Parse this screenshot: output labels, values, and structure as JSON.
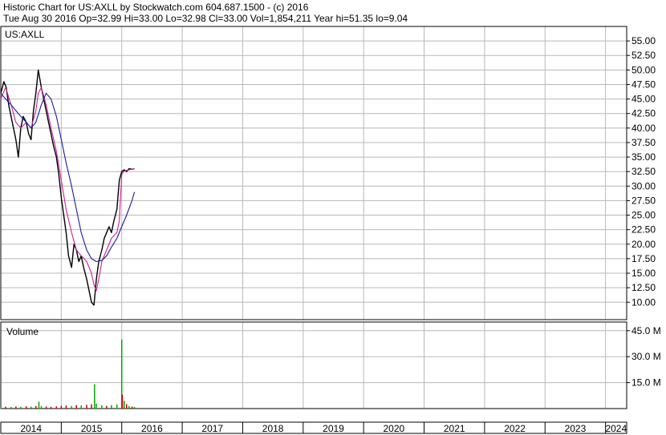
{
  "header": {
    "line1": "Historic Chart for US:AXLL by Stockwatch.com 604.687.1500 - (c) 2016",
    "line2": "Tue Aug 30 2016  Op=32.99  Hi=33.00  Lo=32.98  Cl=33.00  Vol=1,854,211  Year hi=51.35  lo=9.04"
  },
  "chart_data": [
    {
      "type": "line",
      "title": "US:AXLL",
      "ylim": [
        7,
        57.5
      ],
      "y_ticks": [
        "55.00",
        "52.50",
        "50.00",
        "47.50",
        "45.00",
        "42.50",
        "40.00",
        "37.50",
        "35.00",
        "32.50",
        "30.00",
        "27.50",
        "25.00",
        "22.50",
        "20.00",
        "17.50",
        "15.00",
        "12.50",
        "10.00"
      ],
      "y_tick_values": [
        55,
        52.5,
        50,
        47.5,
        45,
        42.5,
        40,
        37.5,
        35,
        32.5,
        30,
        27.5,
        25,
        22.5,
        20,
        17.5,
        15,
        12.5,
        10
      ],
      "x_ticks": [
        "2014",
        "2015",
        "2016",
        "2017",
        "2018",
        "2019",
        "2020",
        "2021",
        "2022",
        "2023",
        "2024"
      ],
      "xlim": [
        2014,
        2024.35
      ],
      "grid": true,
      "price_color": "#000000",
      "series": [
        {
          "kind": "price",
          "x": [
            2014.0,
            2014.05,
            2014.09,
            2014.13,
            2014.17,
            2014.21,
            2014.25,
            2014.29,
            2014.33,
            2014.37,
            2014.42,
            2014.46,
            2014.5,
            2014.54,
            2014.58,
            2014.62,
            2014.67,
            2014.71,
            2014.75,
            2014.79,
            2014.83,
            2014.87,
            2014.92,
            2014.96,
            2015.0,
            2015.04,
            2015.08,
            2015.12,
            2015.17,
            2015.21,
            2015.25,
            2015.29,
            2015.33,
            2015.37,
            2015.42,
            2015.46,
            2015.5,
            2015.54,
            2015.58,
            2015.62,
            2015.67,
            2015.71,
            2015.75,
            2015.79,
            2015.83,
            2015.87,
            2015.92,
            2015.96,
            2016.0,
            2016.04,
            2016.08,
            2016.12,
            2016.17,
            2016.21
          ],
          "y": [
            46,
            48,
            47,
            44,
            42,
            40,
            38,
            35,
            40,
            42,
            41,
            39,
            38,
            43,
            46,
            50,
            47,
            45,
            43,
            41,
            39,
            37,
            35,
            32,
            28,
            25,
            22,
            18,
            16,
            20,
            19,
            17,
            18,
            16,
            14,
            12,
            10,
            9.5,
            14,
            17,
            19,
            21,
            22,
            23,
            22,
            24,
            26,
            31,
            32.5,
            32.8,
            32.5,
            33,
            32.9,
            33
          ]
        },
        {
          "kind": "moving_average_short",
          "color": "#cc2299",
          "x": [
            2014.0,
            2014.08,
            2014.17,
            2014.25,
            2014.33,
            2014.42,
            2014.5,
            2014.58,
            2014.62,
            2014.67,
            2014.75,
            2014.83,
            2014.92,
            2015.0,
            2015.08,
            2015.17,
            2015.25,
            2015.33,
            2015.42,
            2015.5,
            2015.54,
            2015.58,
            2015.62,
            2015.67,
            2015.75,
            2015.83,
            2015.92,
            2015.96,
            2016.0,
            2016.04,
            2016.08,
            2016.12,
            2016.17,
            2016.21
          ],
          "y": [
            45,
            47,
            44,
            41,
            40,
            41,
            40,
            43,
            46,
            47,
            44,
            40,
            36,
            31,
            26,
            22,
            19,
            18,
            17,
            15,
            13,
            12,
            14,
            17,
            19,
            21,
            22,
            24,
            32,
            32.6,
            32.7,
            32.8,
            32.9,
            33
          ]
        },
        {
          "kind": "moving_average_long",
          "color": "#1a1aa0",
          "x": [
            2014.0,
            2014.08,
            2014.17,
            2014.25,
            2014.33,
            2014.42,
            2014.5,
            2014.58,
            2014.67,
            2014.75,
            2014.83,
            2014.92,
            2015.0,
            2015.08,
            2015.17,
            2015.25,
            2015.33,
            2015.42,
            2015.5,
            2015.58,
            2015.67,
            2015.75,
            2015.83,
            2015.92,
            2016.0,
            2016.08,
            2016.17,
            2016.21
          ],
          "y": [
            46,
            45,
            44,
            43,
            42,
            41,
            40,
            41,
            44,
            46,
            45,
            42,
            38,
            34,
            30,
            26,
            22,
            19,
            17.5,
            17,
            17.2,
            18,
            19.5,
            21,
            23,
            25,
            27.5,
            29
          ]
        }
      ]
    },
    {
      "type": "bar",
      "title": "Volume",
      "ylim": [
        0,
        50
      ],
      "y_ticks": [
        "45.0 M",
        "30.0 M",
        "15.0 M"
      ],
      "y_tick_values": [
        45,
        30,
        15
      ],
      "xlim": [
        2014,
        2024.35
      ],
      "colors": {
        "up": "#00aa00",
        "down": "#cc0000"
      },
      "x": [
        2014.0,
        2014.08,
        2014.17,
        2014.25,
        2014.33,
        2014.42,
        2014.5,
        2014.58,
        2014.63,
        2014.67,
        2014.75,
        2014.83,
        2014.92,
        2015.0,
        2015.08,
        2015.17,
        2015.25,
        2015.33,
        2015.42,
        2015.5,
        2015.55,
        2015.58,
        2015.67,
        2015.75,
        2015.83,
        2015.92,
        2016.0,
        2016.01,
        2016.04,
        2016.08,
        2016.12,
        2016.17,
        2016.21
      ],
      "values": [
        0.8,
        1.1,
        0.9,
        1.2,
        1.0,
        1.3,
        1.1,
        1.5,
        4.0,
        1.4,
        1.2,
        1.0,
        1.3,
        1.6,
        1.8,
        1.5,
        2.0,
        1.8,
        2.2,
        2.5,
        14.0,
        2.8,
        1.9,
        1.6,
        2.0,
        2.4,
        40.0,
        8.0,
        4.5,
        2.5,
        1.5,
        1.2,
        1.0
      ],
      "up": [
        true,
        false,
        true,
        false,
        true,
        false,
        true,
        false,
        true,
        true,
        false,
        false,
        false,
        false,
        false,
        true,
        false,
        true,
        false,
        false,
        true,
        true,
        true,
        false,
        true,
        true,
        true,
        false,
        true,
        false,
        true,
        false,
        true
      ]
    }
  ]
}
